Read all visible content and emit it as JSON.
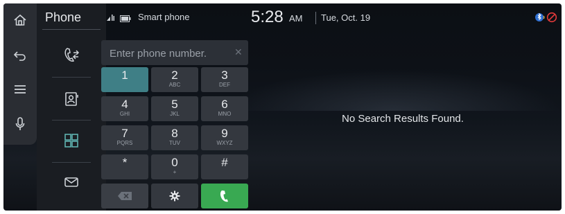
{
  "header": {
    "app_title": "Phone",
    "device_label": "Smart phone",
    "time": "5:28",
    "ampm": "AM",
    "date": "Tue, Oct. 19"
  },
  "left_rail": {
    "icons": [
      "home-icon",
      "back-icon",
      "menu-icon",
      "microphone-icon"
    ]
  },
  "phone_nav": {
    "icons": [
      "call-history-icon",
      "contacts-icon",
      "keypad-icon",
      "messages-icon"
    ],
    "selected": "keypad"
  },
  "search": {
    "placeholder": "Enter phone number.",
    "value": ""
  },
  "keypad": {
    "keys": [
      {
        "digit": "1",
        "letters": ""
      },
      {
        "digit": "2",
        "letters": "ABC"
      },
      {
        "digit": "3",
        "letters": "DEF"
      },
      {
        "digit": "4",
        "letters": "GHI"
      },
      {
        "digit": "5",
        "letters": "JKL"
      },
      {
        "digit": "6",
        "letters": "MNO"
      },
      {
        "digit": "7",
        "letters": "PQRS"
      },
      {
        "digit": "8",
        "letters": "TUV"
      },
      {
        "digit": "9",
        "letters": "WXYZ"
      },
      {
        "digit": "*",
        "letters": ""
      },
      {
        "digit": "0",
        "letters": "+"
      },
      {
        "digit": "#",
        "letters": ""
      }
    ],
    "pressed_key": "1"
  },
  "results": {
    "message": "No Search Results Found."
  },
  "colors": {
    "accent_call": "#39a952",
    "pressed_key": "#3f7f86",
    "background": "#0d1117"
  }
}
